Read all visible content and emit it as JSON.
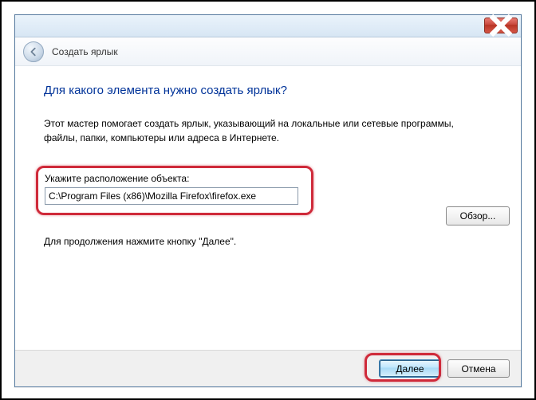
{
  "titlebar": {},
  "header": {
    "title": "Создать ярлык"
  },
  "main": {
    "heading": "Для какого элемента нужно создать ярлык?",
    "description": "Этот мастер помогает создать ярлык, указывающий на локальные или сетевые программы, файлы, папки, компьютеры или адреса в Интернете.",
    "field_label": "Укажите расположение объекта:",
    "path_value": "C:\\Program Files (x86)\\Mozilla Firefox\\firefox.exe",
    "browse_label": "Обзор...",
    "continue_hint": "Для продолжения нажмите кнопку \"Далее\"."
  },
  "footer": {
    "next_label": "Далее",
    "cancel_label": "Отмена"
  }
}
